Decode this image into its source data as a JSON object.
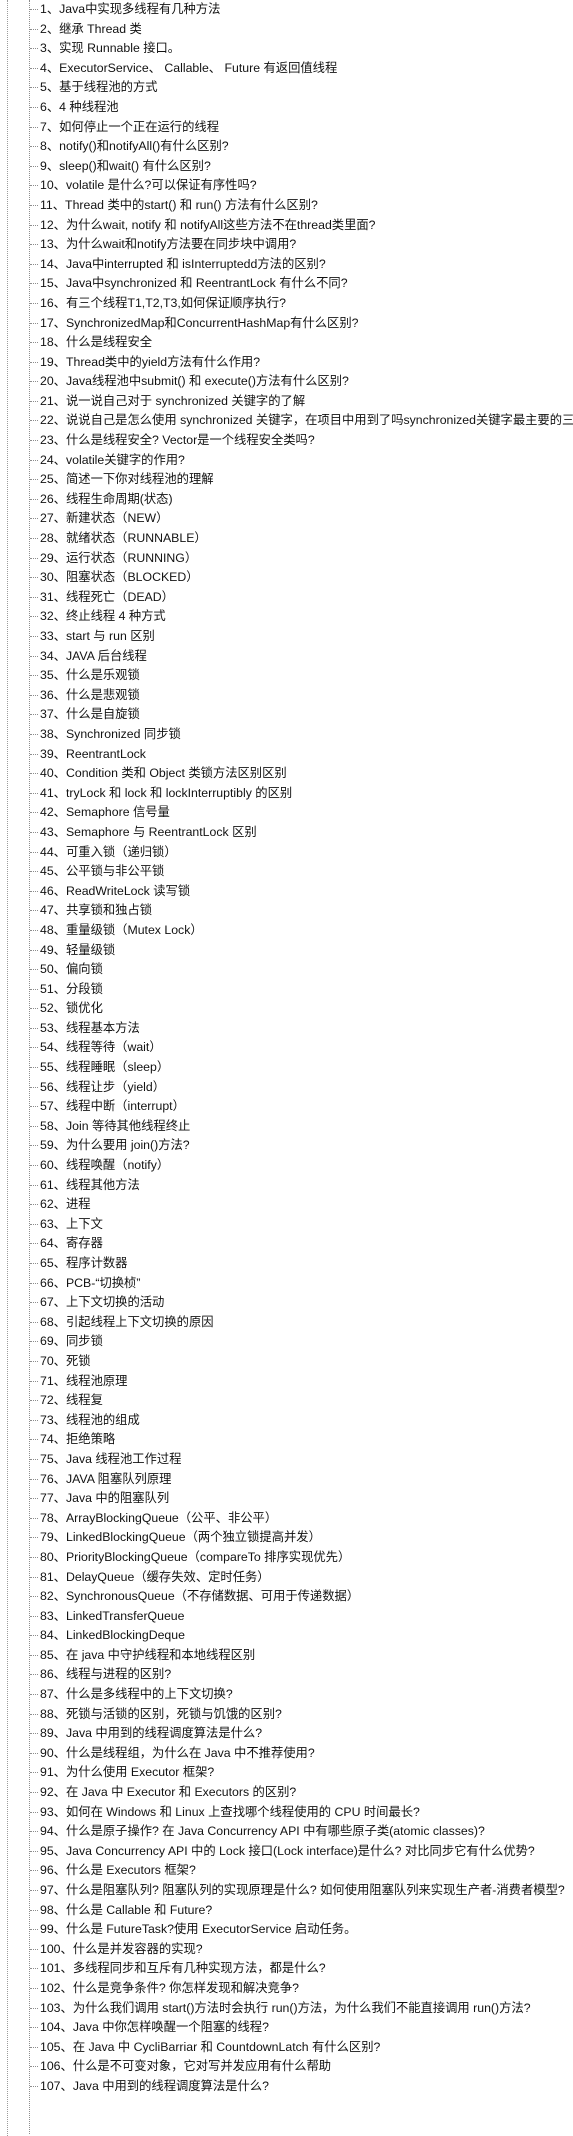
{
  "document": {
    "title": "Java 多线程面试题目录",
    "view": "outline-tree",
    "item_count": 107,
    "colors": {
      "background": "#ffffff",
      "text": "#121212",
      "tree_line": "#8c8c8c"
    }
  },
  "outline": {
    "items": [
      {
        "index": 1,
        "text": "1、Java中实现多线程有几种方法"
      },
      {
        "index": 2,
        "text": "2、继承 Thread 类"
      },
      {
        "index": 3,
        "text": "3、实现 Runnable 接口。"
      },
      {
        "index": 4,
        "text": "4、ExecutorService、 Callable、 Future 有返回值线程"
      },
      {
        "index": 5,
        "text": "5、基于线程池的方式"
      },
      {
        "index": 6,
        "text": "6、4 种线程池"
      },
      {
        "index": 7,
        "text": "7、如何停止一个正在运行的线程"
      },
      {
        "index": 8,
        "text": "8、notify()和notifyAll()有什么区别?"
      },
      {
        "index": 9,
        "text": "9、sleep()和wait() 有什么区别?"
      },
      {
        "index": 10,
        "text": "10、volatile 是什么?可以保证有序性吗?"
      },
      {
        "index": 11,
        "text": "11、Thread 类中的start() 和 run() 方法有什么区别?"
      },
      {
        "index": 12,
        "text": "12、为什么wait, notify 和 notifyAll这些方法不在thread类里面?"
      },
      {
        "index": 13,
        "text": "13、为什么wait和notify方法要在同步块中调用?"
      },
      {
        "index": 14,
        "text": "14、Java中interrupted 和 isInterruptedd方法的区别?"
      },
      {
        "index": 15,
        "text": "15、Java中synchronized 和 ReentrantLock 有什么不同?"
      },
      {
        "index": 16,
        "text": "16、有三个线程T1,T2,T3,如何保证顺序执行?"
      },
      {
        "index": 17,
        "text": "17、SynchronizedMap和ConcurrentHashMap有什么区别?"
      },
      {
        "index": 18,
        "text": "18、什么是线程安全"
      },
      {
        "index": 19,
        "text": "19、Thread类中的yield方法有什么作用?"
      },
      {
        "index": 20,
        "text": "20、Java线程池中submit() 和 execute()方法有什么区别?"
      },
      {
        "index": 21,
        "text": "21、说一说自己对于 synchronized 关键字的了解"
      },
      {
        "index": 22,
        "text": "22、说说自己是怎么使用 synchronized 关键字，在项目中用到了吗synchronized关键字最主要的三"
      },
      {
        "index": 23,
        "text": "23、什么是线程安全? Vector是一个线程安全类吗?"
      },
      {
        "index": 24,
        "text": "24、volatile关键字的作用?"
      },
      {
        "index": 25,
        "text": "25、简述一下你对线程池的理解"
      },
      {
        "index": 26,
        "text": "26、线程生命周期(状态)"
      },
      {
        "index": 27,
        "text": "27、新建状态（NEW）"
      },
      {
        "index": 28,
        "text": "28、就绪状态（RUNNABLE）"
      },
      {
        "index": 29,
        "text": "29、运行状态（RUNNING）"
      },
      {
        "index": 30,
        "text": "30、阻塞状态（BLOCKED）"
      },
      {
        "index": 31,
        "text": "31、线程死亡（DEAD）"
      },
      {
        "index": 32,
        "text": "32、终止线程 4 种方式"
      },
      {
        "index": 33,
        "text": "33、start 与 run 区别"
      },
      {
        "index": 34,
        "text": "34、JAVA 后台线程"
      },
      {
        "index": 35,
        "text": "35、什么是乐观锁"
      },
      {
        "index": 36,
        "text": "36、什么是悲观锁"
      },
      {
        "index": 37,
        "text": "37、什么是自旋锁"
      },
      {
        "index": 38,
        "text": "38、Synchronized 同步锁"
      },
      {
        "index": 39,
        "text": "39、ReentrantLock"
      },
      {
        "index": 40,
        "text": "40、Condition 类和 Object 类锁方法区别区别"
      },
      {
        "index": 41,
        "text": "41、tryLock 和 lock 和 lockInterruptibly 的区别"
      },
      {
        "index": 42,
        "text": "42、Semaphore 信号量"
      },
      {
        "index": 43,
        "text": "43、Semaphore 与 ReentrantLock  区别"
      },
      {
        "index": 44,
        "text": "44、可重入锁（递归锁）"
      },
      {
        "index": 45,
        "text": "45、公平锁与非公平锁"
      },
      {
        "index": 46,
        "text": "46、ReadWriteLock 读写锁"
      },
      {
        "index": 47,
        "text": "47、共享锁和独占锁"
      },
      {
        "index": 48,
        "text": "48、重量级锁（Mutex Lock）"
      },
      {
        "index": 49,
        "text": "49、轻量级锁"
      },
      {
        "index": 50,
        "text": "50、偏向锁"
      },
      {
        "index": 51,
        "text": "51、分段锁"
      },
      {
        "index": 52,
        "text": "52、锁优化"
      },
      {
        "index": 53,
        "text": "53、线程基本方法"
      },
      {
        "index": 54,
        "text": "54、线程等待（wait）"
      },
      {
        "index": 55,
        "text": "55、线程睡眠（sleep）"
      },
      {
        "index": 56,
        "text": "56、线程让步（yield）"
      },
      {
        "index": 57,
        "text": "57、线程中断（interrupt）"
      },
      {
        "index": 58,
        "text": "58、Join 等待其他线程终止"
      },
      {
        "index": 59,
        "text": "59、为什么要用 join()方法?"
      },
      {
        "index": 60,
        "text": "60、线程唤醒（notify）"
      },
      {
        "index": 61,
        "text": "61、线程其他方法"
      },
      {
        "index": 62,
        "text": "62、进程"
      },
      {
        "index": 63,
        "text": "63、上下文"
      },
      {
        "index": 64,
        "text": "64、寄存器"
      },
      {
        "index": 65,
        "text": "65、程序计数器"
      },
      {
        "index": 66,
        "text": "66、PCB-“切换桢”"
      },
      {
        "index": 67,
        "text": "67、上下文切换的活动"
      },
      {
        "index": 68,
        "text": "68、引起线程上下文切换的原因"
      },
      {
        "index": 69,
        "text": "69、同步锁"
      },
      {
        "index": 70,
        "text": "70、死锁"
      },
      {
        "index": 71,
        "text": "71、线程池原理"
      },
      {
        "index": 72,
        "text": "72、线程复"
      },
      {
        "index": 73,
        "text": "73、线程池的组成"
      },
      {
        "index": 74,
        "text": "74、拒绝策略"
      },
      {
        "index": 75,
        "text": "75、Java 线程池工作过程"
      },
      {
        "index": 76,
        "text": "76、JAVA 阻塞队列原理"
      },
      {
        "index": 77,
        "text": "77、Java 中的阻塞队列"
      },
      {
        "index": 78,
        "text": "78、ArrayBlockingQueue（公平、非公平）"
      },
      {
        "index": 79,
        "text": "79、LinkedBlockingQueue（两个独立锁提高并发）"
      },
      {
        "index": 80,
        "text": "80、PriorityBlockingQueue（compareTo 排序实现优先）"
      },
      {
        "index": 81,
        "text": "81、DelayQueue（缓存失效、定时任务）"
      },
      {
        "index": 82,
        "text": "82、SynchronousQueue（不存储数据、可用于传递数据）"
      },
      {
        "index": 83,
        "text": "83、LinkedTransferQueue"
      },
      {
        "index": 84,
        "text": "84、LinkedBlockingDeque"
      },
      {
        "index": 85,
        "text": "85、在 java 中守护线程和本地线程区别"
      },
      {
        "index": 86,
        "text": "86、线程与进程的区别?"
      },
      {
        "index": 87,
        "text": "87、什么是多线程中的上下文切换?"
      },
      {
        "index": 88,
        "text": "88、死锁与活锁的区别，死锁与饥饿的区别?"
      },
      {
        "index": 89,
        "text": "89、Java 中用到的线程调度算法是什么?"
      },
      {
        "index": 90,
        "text": "90、什么是线程组，为什么在 Java 中不推荐使用?"
      },
      {
        "index": 91,
        "text": "91、为什么使用 Executor 框架?"
      },
      {
        "index": 92,
        "text": "92、在 Java 中 Executor 和 Executors 的区别?"
      },
      {
        "index": 93,
        "text": "93、如何在 Windows 和 Linux 上查找哪个线程使用的 CPU 时间最长?"
      },
      {
        "index": 94,
        "text": "94、什么是原子操作? 在 Java Concurrency API 中有哪些原子类(atomic classes)?"
      },
      {
        "index": 95,
        "text": "95、Java Concurrency API 中的 Lock 接口(Lock interface)是什么? 对比同步它有什么优势?"
      },
      {
        "index": 96,
        "text": "96、什么是 Executors 框架?"
      },
      {
        "index": 97,
        "text": "97、什么是阻塞队列? 阻塞队列的实现原理是什么? 如何使用阻塞队列来实现生产者-消费者模型?"
      },
      {
        "index": 98,
        "text": "98、什么是 Callable 和 Future?"
      },
      {
        "index": 99,
        "text": "99、什么是 FutureTask?使用 ExecutorService 启动任务。"
      },
      {
        "index": 100,
        "text": "100、什么是并发容器的实现?"
      },
      {
        "index": 101,
        "text": "101、多线程同步和互斥有几种实现方法，都是什么?"
      },
      {
        "index": 102,
        "text": "102、什么是竞争条件? 你怎样发现和解决竞争?"
      },
      {
        "index": 103,
        "text": "103、为什么我们调用 start()方法时会执行 run()方法，为什么我们不能直接调用 run()方法?"
      },
      {
        "index": 104,
        "text": "104、Java 中你怎样唤醒一个阻塞的线程?"
      },
      {
        "index": 105,
        "text": "105、在 Java 中 CycliBarriar 和 CountdownLatch 有什么区别?"
      },
      {
        "index": 106,
        "text": "106、什么是不可变对象，它对写并发应用有什么帮助"
      },
      {
        "index": 107,
        "text": "107、Java 中用到的线程调度算法是什么?"
      }
    ]
  }
}
